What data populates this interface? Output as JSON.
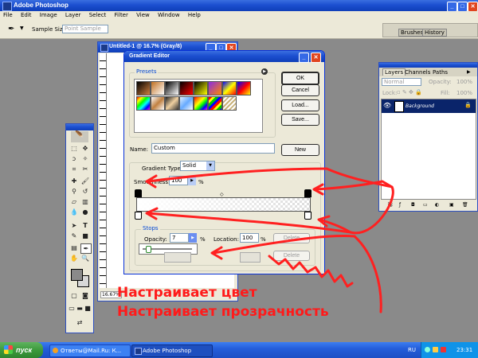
{
  "app": {
    "title": "Adobe Photoshop"
  },
  "menu": [
    "File",
    "Edit",
    "Image",
    "Layer",
    "Select",
    "Filter",
    "View",
    "Window",
    "Help"
  ],
  "options_bar": {
    "sample_size_label": "Sample Size:",
    "sample_size_value": "Point Sample",
    "tab_brushes": "Brushes",
    "tab_history": "History"
  },
  "document": {
    "title": "Untitled-1 @ 16.7% (Gray/8)",
    "zoom": "16.67%"
  },
  "gradient_editor": {
    "title": "Gradient Editor",
    "presets_label": "Presets",
    "ok_label": "OK",
    "cancel_label": "Cancel",
    "load_label": "Load...",
    "save_label": "Save...",
    "name_label": "Name:",
    "name_value": "Custom",
    "new_label": "New",
    "gradient_type_label": "Gradient Type:",
    "gradient_type_value": "Solid",
    "smoothness_label": "Smoothness:",
    "smoothness_value": "100",
    "smoothness_unit": "%",
    "stops_label": "Stops",
    "opacity_label": "Opacity:",
    "opacity_value": "7",
    "percent": "%",
    "location_label": "Location:",
    "location_value": "100",
    "delete_label": "Delete",
    "slider_level": 0.07
  },
  "layers_panel": {
    "tab_layers": "Layers",
    "tab_channels": "Channels",
    "tab_paths": "Paths",
    "mode_value": "Normal",
    "opacity_label": "Opacity:",
    "opacity_value": "100%",
    "lock_label": "Lock:",
    "fill_label": "Fill:",
    "fill_value": "100%",
    "layer_name": "Background"
  },
  "annotations": {
    "line1": "Настраивает цвет",
    "line2": "Настраивает прозрачность",
    "color": "#ff0000"
  },
  "taskbar": {
    "start_label": "пуск",
    "task1": "Ответы@Mail.Ru: К...",
    "task2": "Adobe Photoshop",
    "lang": "RU",
    "clock": "23:31"
  },
  "colors": {
    "xp_blue": "#245edb",
    "start_green": "#3c9a3c",
    "dialog_bg": "#ece9d8"
  }
}
